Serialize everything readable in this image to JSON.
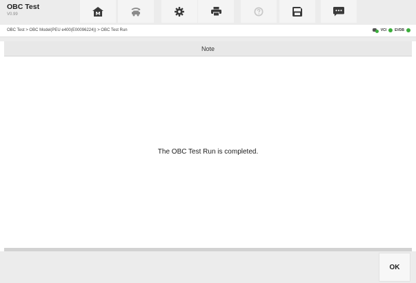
{
  "app": {
    "title": "OBC Test",
    "version": "V0.99"
  },
  "toolbar": {
    "buttons": [
      {
        "name": "home",
        "icon": "home-icon"
      },
      {
        "name": "vehicle-swap",
        "icon": "vehicle-swap-icon"
      },
      {
        "name": "settings",
        "icon": "gear-icon"
      },
      {
        "name": "print",
        "icon": "printer-icon"
      },
      {
        "name": "help",
        "icon": "help-icon"
      },
      {
        "name": "save",
        "icon": "save-icon"
      },
      {
        "name": "data-logging",
        "icon": "message-icon"
      }
    ]
  },
  "breadcrumb": "OBC Test > OBC Model(PEU e400(E00096224)) > OBC Test Run",
  "status": {
    "vci_label": "VCI",
    "evdb_label": "EVDB",
    "connected_color": "#3cae3c"
  },
  "dialog": {
    "title": "Note",
    "message": "The OBC Test Run is completed."
  },
  "footer": {
    "ok_label": "OK"
  }
}
